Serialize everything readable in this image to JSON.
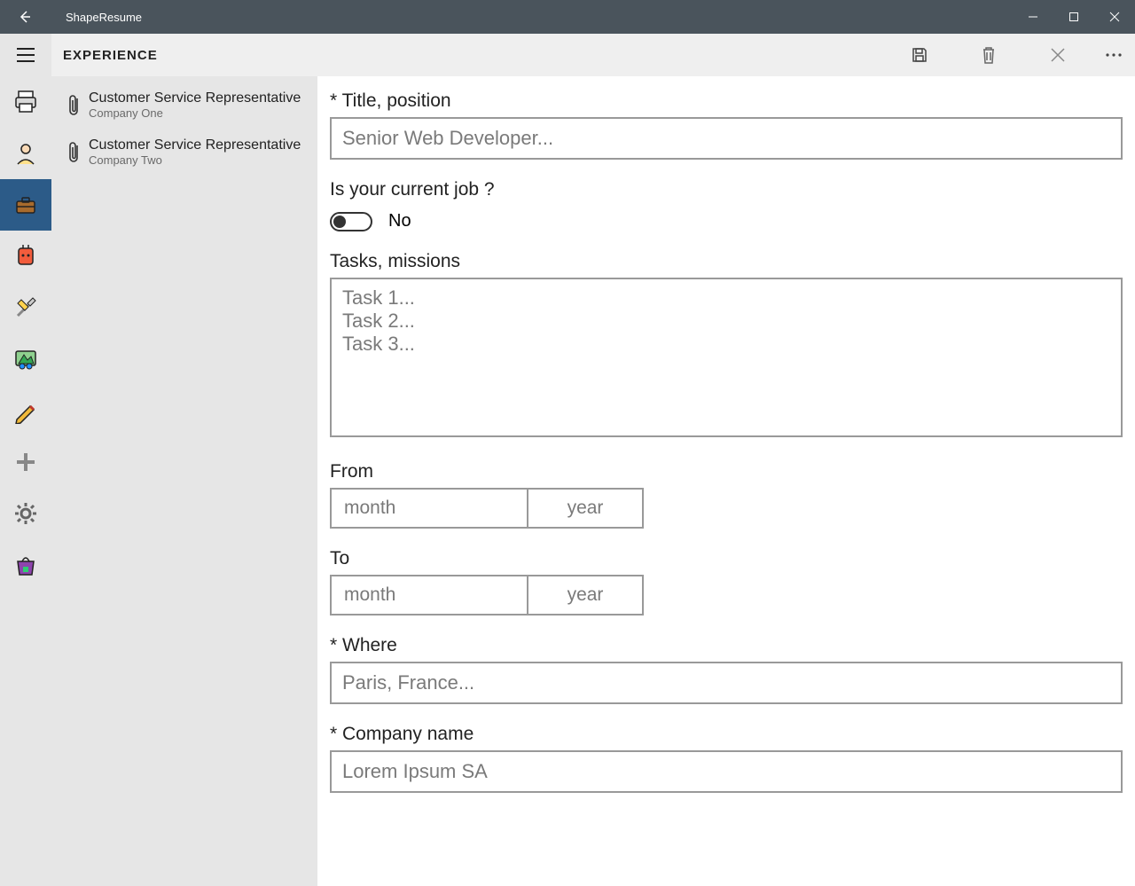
{
  "app": {
    "title": "ShapeResume"
  },
  "section": {
    "header": "EXPERIENCE"
  },
  "toolbar": {
    "save_icon": "save",
    "delete_icon": "delete",
    "close_icon": "close",
    "more_icon": "more"
  },
  "experience_list": [
    {
      "title": "Customer Service Representative",
      "company": "Company One"
    },
    {
      "title": "Customer Service Representative",
      "company": "Company Two"
    }
  ],
  "form": {
    "title_label": "* Title, position",
    "title_placeholder": "Senior Web Developer...",
    "current_job_label": "Is your current job ?",
    "current_job_value": "No",
    "tasks_label": "Tasks, missions",
    "tasks_placeholder": "Task 1...\nTask 2...\nTask 3...",
    "from_label": "From",
    "to_label": "To",
    "date_month_placeholder": "month",
    "date_year_placeholder": "year",
    "where_label": "* Where",
    "where_placeholder": "Paris, France...",
    "company_label": "* Company name",
    "company_placeholder": "Lorem Ipsum SA"
  }
}
